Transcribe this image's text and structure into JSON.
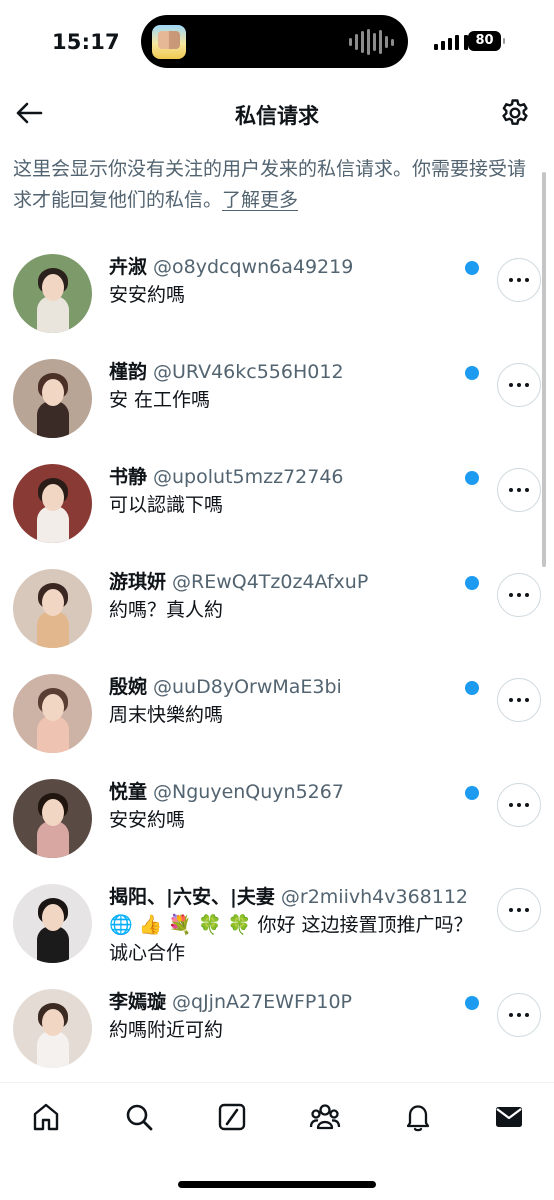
{
  "status_bar": {
    "time": "15:17",
    "battery": "80"
  },
  "header": {
    "title": "私信请求"
  },
  "intro": {
    "text": "这里会显示你没有关注的用户发来的私信请求。你需要接受请求才能回复他们的私信。",
    "link": "了解更多"
  },
  "requests": [
    {
      "name": "卉淑",
      "handle": "@o8ydcqwn6a49219",
      "message": "安安約嗎",
      "unread": true,
      "colors": {
        "bg": "#7d9a6a",
        "top": "#e9e4dc",
        "hair": "#2b211c"
      }
    },
    {
      "name": "槿韵",
      "handle": "@URV46kc556H012",
      "message": "安 在工作嗎",
      "unread": true,
      "colors": {
        "bg": "#b9a596",
        "top": "#3b2b27",
        "hair": "#4a3026"
      }
    },
    {
      "name": "书静",
      "handle": "@upolut5mzz72746",
      "message": "可以認識下嗎",
      "unread": true,
      "colors": {
        "bg": "#8a3a34",
        "top": "#f2ede8",
        "hair": "#2a1d18"
      }
    },
    {
      "name": "游琪妍",
      "handle": "@REwQ4Tz0z4AfxuP",
      "message": "約嗎？真人約",
      "unread": true,
      "colors": {
        "bg": "#d8c8bc",
        "top": "#e3b78d",
        "hair": "#3a2722"
      }
    },
    {
      "name": "殷婉",
      "handle": "@uuD8yOrwMaE3bi",
      "message": "周末快樂約嗎",
      "unread": true,
      "colors": {
        "bg": "#cdb3a6",
        "top": "#efc3b1",
        "hair": "#5a3e33"
      }
    },
    {
      "name": "悦童",
      "handle": "@NguyenQuyn5267",
      "message": "安安約嗎",
      "unread": true,
      "colors": {
        "bg": "#5a4a44",
        "top": "#d9a7a2",
        "hair": "#21160f"
      }
    },
    {
      "name": "揭阳、|六安、|夫妻",
      "handle": "@r2miivh4v368112",
      "message": "🌐 👍 💐 🍀 🍀 你好 这边接置顶推广吗？诚心合作",
      "unread": false,
      "colors": {
        "bg": "#e7e4e6",
        "top": "#1b1b1b",
        "hair": "#1a1512"
      }
    },
    {
      "name": "李嫣璇",
      "handle": "@qJjnA27EWFP10P",
      "message": "約嗎附近可約",
      "unread": true,
      "colors": {
        "bg": "#e4dcd4",
        "top": "#f4f1ee",
        "hair": "#3a2a22"
      }
    }
  ],
  "tabbar": {
    "items": [
      "home-icon",
      "search-icon",
      "grok-icon",
      "communities-icon",
      "notifications-icon",
      "messages-icon"
    ]
  },
  "colors": {
    "accent": "#1d9bf0",
    "secondary_text": "#536471"
  }
}
